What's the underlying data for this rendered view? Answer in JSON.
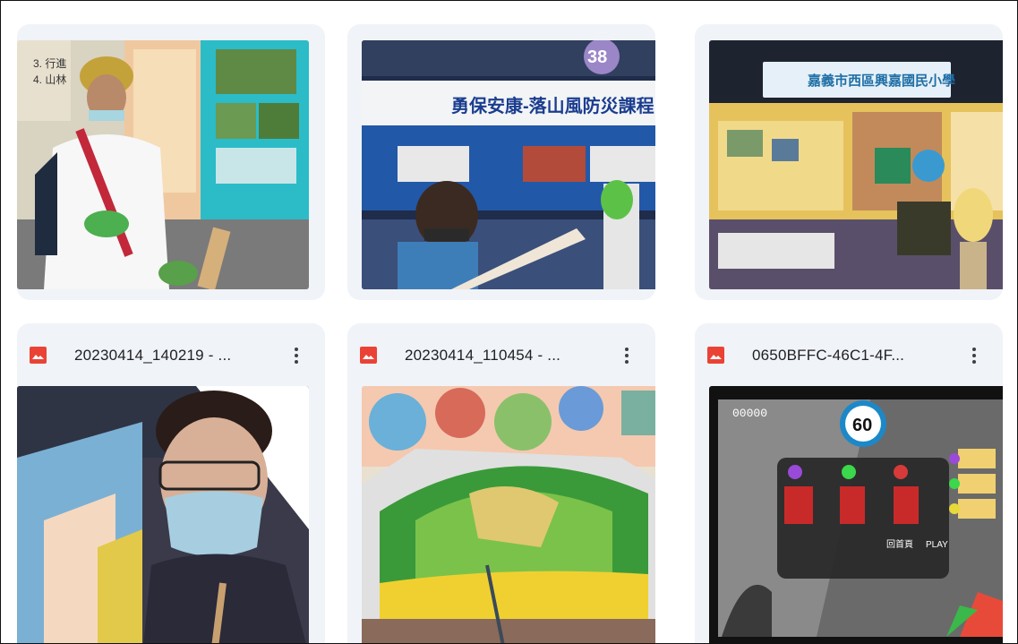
{
  "files": [
    {
      "name": "20230414_140219 - ...",
      "icon": "image-icon"
    },
    {
      "name": "20230414_110454 - ...",
      "icon": "image-icon"
    },
    {
      "name": "0650BFFC-46C1-4F...",
      "icon": "image-icon"
    }
  ],
  "photos": {
    "p2_banner_title": "勇保安康-落山風防災課程",
    "p2_badge": "38",
    "p3_banner": "嘉義市西區興嘉國民小學",
    "game": {
      "score": "00000",
      "timer": "60",
      "play": "PLAY",
      "back": "回首頁"
    }
  },
  "colors": {
    "card_bg": "#f0f3f8",
    "image_icon": "#ea4335"
  }
}
